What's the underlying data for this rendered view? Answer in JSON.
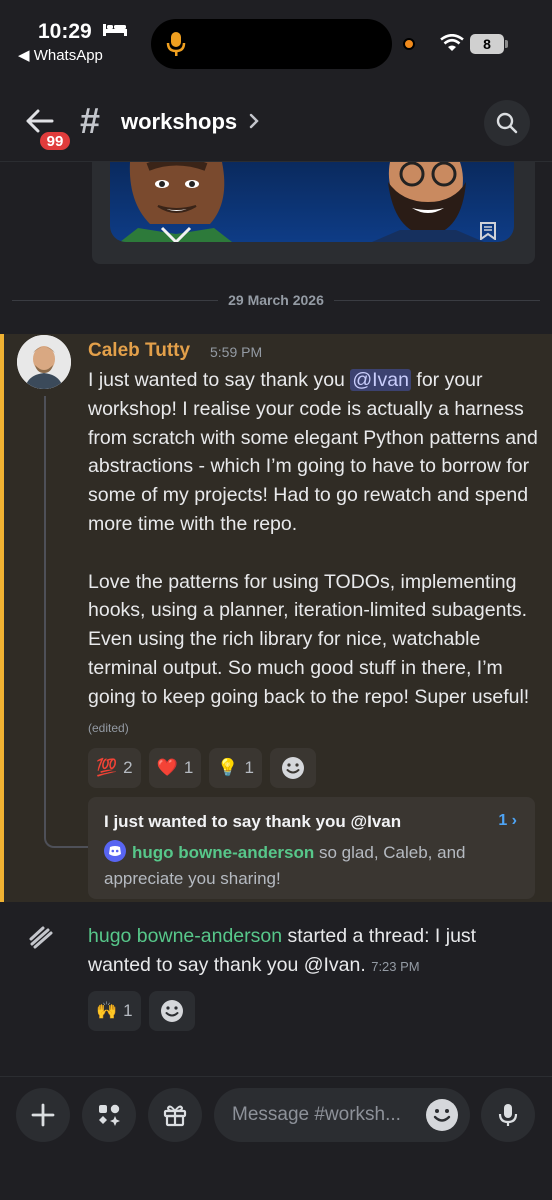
{
  "status_bar": {
    "time": "10:29",
    "back_app": "◀ WhatsApp",
    "battery": "8"
  },
  "header": {
    "unread_badge": "99",
    "hash": "#",
    "channel": "workshops",
    "chevron": "›"
  },
  "date_divider": "29 March 2026",
  "message": {
    "author": "Caleb Tutty",
    "time": "5:59 PM",
    "text_before_mention": "I just wanted to say thank you ",
    "mention": "@Ivan",
    "text_after_mention": " for your workshop! I realise your code is actually a harness from scratch with some elegant Python patterns and abstractions - which I’m going to have to borrow for some of my projects! Had to go rewatch and spend more time with the repo.",
    "paragraph_2": "Love the patterns for using TODOs, implementing hooks, using a planner, iteration-limited subagents. Even using the rich library for nice, watchable terminal output. So much good stuff in there, I’m going to keep going back to the repo! Super useful!",
    "edited": "(edited)",
    "reactions": [
      {
        "emoji": "💯",
        "count": "2"
      },
      {
        "emoji": "❤️",
        "count": "1"
      },
      {
        "emoji": "💡",
        "count": "1"
      }
    ]
  },
  "thread": {
    "title": "I just wanted to say thank you @Ivan",
    "count": "1 ›",
    "reply_author": "hugo bowne-anderson",
    "reply_text": " so glad, Caleb, and appreciate you sharing!"
  },
  "system_message": {
    "actor": "hugo bowne-anderson",
    "action": " started a thread: ",
    "thread_name": "I just wanted to say thank you @Ivan.",
    "time": "7:23 PM",
    "reactions": [
      {
        "emoji": "🙌",
        "count": "1"
      }
    ]
  },
  "composer": {
    "placeholder": "Message #worksh..."
  },
  "colors": {
    "accent_mention": "#f0b232",
    "author": "#e3a04a",
    "green_name": "#57c78a",
    "link_blue": "#4ea4f5",
    "badge_red": "#e03c3c"
  }
}
